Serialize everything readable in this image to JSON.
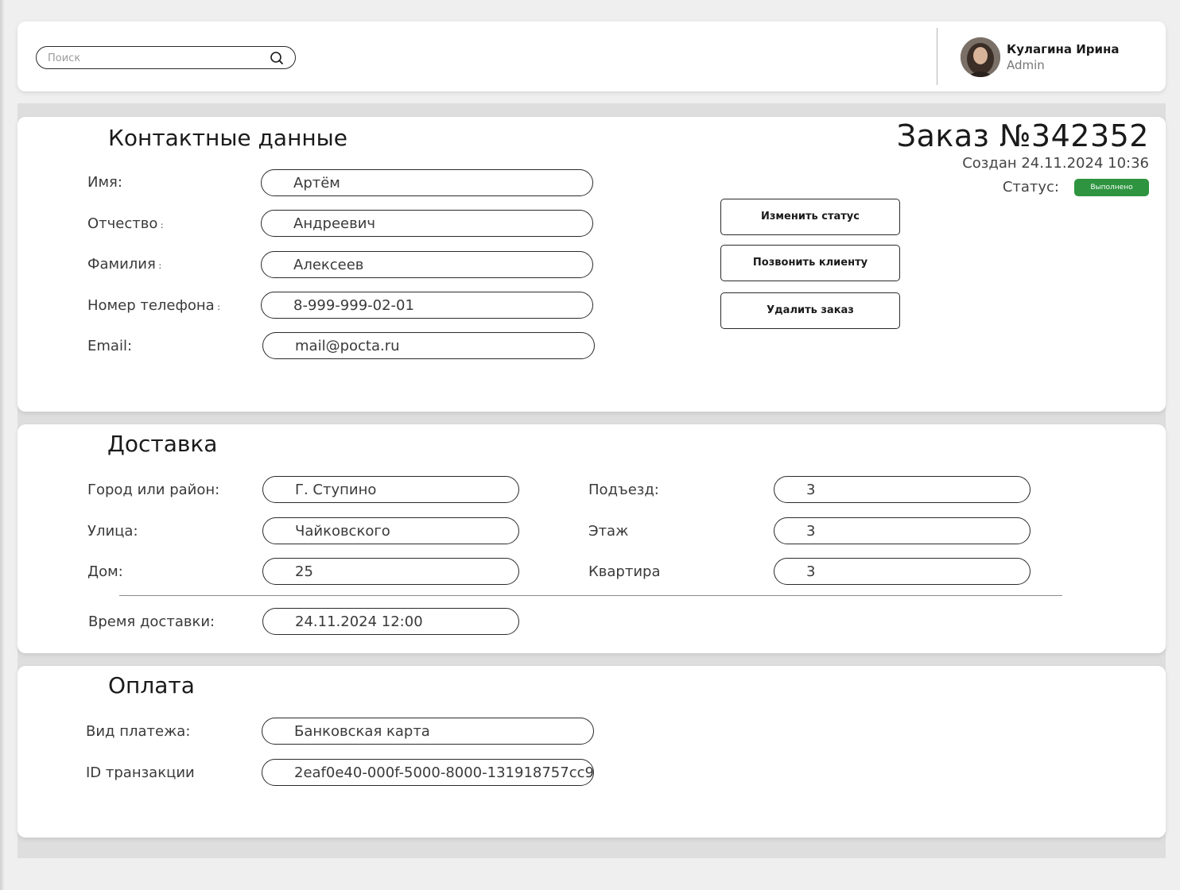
{
  "header": {
    "search_placeholder": "Поиск",
    "user_name": "Кулагина Ирина",
    "user_role": "Admin"
  },
  "contact": {
    "title": "Контактные данные",
    "order_title": "Заказ  №342352",
    "created": "Создан 24.11.2024 10:36",
    "status_label": "Статус:",
    "status_value": "Выполнено",
    "status_color": "#2e9440",
    "fields": {
      "first_name": {
        "label": "Имя:",
        "value": "Артём"
      },
      "patronymic": {
        "label": "Отчество",
        "value": "Андреевич"
      },
      "last_name": {
        "label": "Фамилия",
        "value": "Алексеев"
      },
      "phone": {
        "label": "Номер телефона",
        "value": "8-999-999-02-01"
      },
      "email": {
        "label": "Email:",
        "value": "mail@pocta.ru"
      }
    },
    "buttons": {
      "change_status": "Изменить статус",
      "call_client": "Позвонить клиенту",
      "delete_order": "Удалить заказ"
    }
  },
  "delivery": {
    "title": "Доставка",
    "fields": {
      "city": {
        "label": "Город или район:",
        "value": "Г. Ступино"
      },
      "street": {
        "label": "Улица:",
        "value": "Чайковского"
      },
      "house": {
        "label": "Дом:",
        "value": "25"
      },
      "entrance": {
        "label": "Подъезд:",
        "value": "3"
      },
      "floor": {
        "label": "Этаж",
        "value": "3"
      },
      "apartment": {
        "label": "Квартира",
        "value": "3"
      },
      "time": {
        "label": "Время доставки:",
        "value": "24.11.2024 12:00"
      }
    }
  },
  "payment": {
    "title": "Оплата",
    "fields": {
      "method": {
        "label": "Вид платежа:",
        "value": "Банковская карта"
      },
      "transaction": {
        "label": "ID транзакции",
        "value": "2eaf0e40-000f-5000-8000-131918757cc9"
      }
    }
  }
}
